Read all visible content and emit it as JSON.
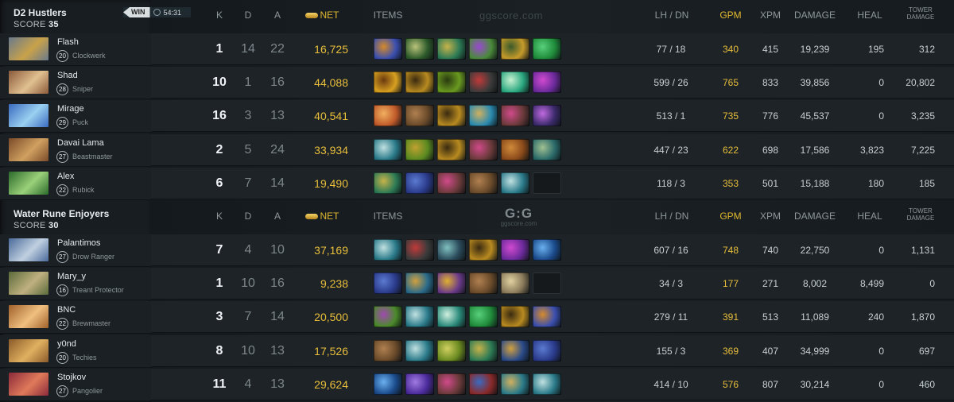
{
  "columns": {
    "k": "K",
    "d": "D",
    "a": "A",
    "net": "NET",
    "items": "ITEMS",
    "lhdn": "LH / DN",
    "gpm": "GPM",
    "xpm": "XPM",
    "damage": "DAMAGE",
    "heal": "HEAL",
    "tower_line1": "TOWER",
    "tower_line2": "DAMAGE"
  },
  "watermark": {
    "site": "ggscore.com",
    "logo": "G:G"
  },
  "match": {
    "result": "WIN",
    "time": "54:31"
  },
  "teams": [
    {
      "name": "D2 Hustlers",
      "score_label": "SCORE",
      "score": "35",
      "players": [
        {
          "name": "Flash",
          "level": "20",
          "hero": "Clockwerk",
          "k": "1",
          "d": "14",
          "a": "22",
          "net": "16,725",
          "lhdn": "77  /  18",
          "gpm": "340",
          "xpm": "415",
          "damage": "19,239",
          "heal": "195",
          "tower": "312",
          "portrait": [
            "#6a7a8c",
            "#c9a24a"
          ],
          "items": [
            [
              "#3a4fb0",
              "#d58a2a"
            ],
            [
              "#2c5a2a",
              "#b9c27a"
            ],
            [
              "#2c7a55",
              "#c6b24a"
            ],
            [
              "#4a8a3a",
              "#9a4ad0"
            ],
            [
              "#c69a2a",
              "#3a5a2a"
            ],
            [
              "#1f8a3a",
              "#58d07a"
            ]
          ]
        },
        {
          "name": "Shad",
          "level": "28",
          "hero": "Sniper",
          "k": "10",
          "d": "1",
          "a": "16",
          "net": "44,088",
          "lhdn": "599  /  26",
          "gpm": "765",
          "xpm": "833",
          "damage": "39,856",
          "heal": "0",
          "tower": "20,802",
          "portrait": [
            "#8a5a3a",
            "#e0c090"
          ],
          "items": [
            [
              "#d8a020",
              "#6a3a10"
            ],
            [
              "#b88a20",
              "#3a2a10"
            ],
            [
              "#6a9a20",
              "#2a3a10"
            ],
            [
              "#3a3a3a",
              "#c03a3a"
            ],
            [
              "#2aa880",
              "#c8f0d0"
            ],
            [
              "#6a2a9a",
              "#d04ad0"
            ]
          ]
        },
        {
          "name": "Mirage",
          "level": "29",
          "hero": "Puck",
          "k": "16",
          "d": "3",
          "a": "13",
          "net": "40,541",
          "lhdn": "513  /  1",
          "gpm": "735",
          "xpm": "776",
          "damage": "45,537",
          "heal": "0",
          "tower": "3,235",
          "portrait": [
            "#3a6ac0",
            "#9ad0f0"
          ],
          "items": [
            [
              "#c05a2a",
              "#f0b060"
            ],
            [
              "#6a4a2a",
              "#b08050"
            ],
            [
              "#b88a20",
              "#3a2a10"
            ],
            [
              "#2a8ab0",
              "#d0b060"
            ],
            [
              "#6a3a3a",
              "#d04a8a"
            ],
            [
              "#3a2a6a",
              "#c06ae0"
            ]
          ]
        },
        {
          "name": "Davai Lama",
          "level": "27",
          "hero": "Beastmaster",
          "k": "2",
          "d": "5",
          "a": "24",
          "net": "33,934",
          "lhdn": "447  /  23",
          "gpm": "622",
          "xpm": "698",
          "damage": "17,586",
          "heal": "3,823",
          "tower": "7,225",
          "portrait": [
            "#7a4a2a",
            "#d0a060"
          ],
          "items": [
            [
              "#2a7a8a",
              "#c0e0e0"
            ],
            [
              "#5a8a20",
              "#c0a030"
            ],
            [
              "#b88a20",
              "#3a2a10"
            ],
            [
              "#6a3a3a",
              "#d04a8a"
            ],
            [
              "#8a4a1a",
              "#d08a3a"
            ],
            [
              "#2a6a6a",
              "#a0c090"
            ]
          ]
        },
        {
          "name": "Alex",
          "level": "22",
          "hero": "Rubick",
          "k": "6",
          "d": "7",
          "a": "14",
          "net": "19,490",
          "lhdn": "118  /  3",
          "gpm": "353",
          "xpm": "501",
          "damage": "15,188",
          "heal": "180",
          "tower": "185",
          "portrait": [
            "#2a6a2a",
            "#9ad07a"
          ],
          "items": [
            [
              "#2c7a55",
              "#c6b24a"
            ],
            [
              "#2a3a8a",
              "#5a7ad0"
            ],
            [
              "#6a3a3a",
              "#d04a8a"
            ],
            [
              "#6a4a2a",
              "#b08050"
            ],
            [
              "#2a7a8a",
              "#c0e0e0"
            ],
            null
          ]
        }
      ]
    },
    {
      "name": "Water Rune Enjoyers",
      "score_label": "SCORE",
      "score": "30",
      "players": [
        {
          "name": "Palantimos",
          "level": "27",
          "hero": "Drow Ranger",
          "k": "7",
          "d": "4",
          "a": "10",
          "net": "37,169",
          "lhdn": "607  /  16",
          "gpm": "748",
          "xpm": "740",
          "damage": "22,750",
          "heal": "0",
          "tower": "1,131",
          "portrait": [
            "#4a6a9a",
            "#c0d0e0"
          ],
          "items": [
            [
              "#2a7a8a",
              "#c0e0e0"
            ],
            [
              "#3a3a3a",
              "#c03a3a"
            ],
            [
              "#2a4a5a",
              "#80c0c0"
            ],
            [
              "#b88a20",
              "#3a2a10"
            ],
            [
              "#6a2a9a",
              "#d04ad0"
            ],
            [
              "#1a4a8a",
              "#6ab0f0"
            ]
          ]
        },
        {
          "name": "Mary_y",
          "level": "16",
          "hero": "Treant Protector",
          "k": "1",
          "d": "10",
          "a": "16",
          "net": "9,238",
          "lhdn": "34  /  3",
          "gpm": "177",
          "xpm": "271",
          "damage": "8,002",
          "heal": "8,499",
          "tower": "0",
          "portrait": [
            "#5a6a3a",
            "#c0b080"
          ],
          "items": [
            [
              "#2a3a8a",
              "#5a7ad0"
            ],
            [
              "#2a6a8a",
              "#d0a040"
            ],
            [
              "#6a3a8a",
              "#e0b030"
            ],
            [
              "#6a4a2a",
              "#b08050"
            ],
            [
              "#8a7a5a",
              "#e0d0a0"
            ],
            null
          ]
        },
        {
          "name": "BNC",
          "level": "22",
          "hero": "Brewmaster",
          "k": "3",
          "d": "7",
          "a": "14",
          "net": "20,500",
          "lhdn": "279  /  11",
          "gpm": "391",
          "xpm": "513",
          "damage": "11,089",
          "heal": "240",
          "tower": "1,870",
          "portrait": [
            "#a0602a",
            "#f0c080"
          ],
          "items": [
            [
              "#4a8a2a",
              "#a04ab0"
            ],
            [
              "#2a7a8a",
              "#c0e0e0"
            ],
            [
              "#2a8a7a",
              "#d0f0e0"
            ],
            [
              "#1f8a3a",
              "#58d07a"
            ],
            [
              "#b88a20",
              "#3a2a10"
            ],
            [
              "#3a4fb0",
              "#d58a2a"
            ]
          ]
        },
        {
          "name": "y0nd",
          "level": "20",
          "hero": "Techies",
          "k": "8",
          "d": "10",
          "a": "13",
          "net": "17,526",
          "lhdn": "155  /  3",
          "gpm": "369",
          "xpm": "407",
          "damage": "34,999",
          "heal": "0",
          "tower": "697",
          "portrait": [
            "#8a5a2a",
            "#e0b060"
          ],
          "items": [
            [
              "#6a4a2a",
              "#b08050"
            ],
            [
              "#2a7a8a",
              "#c0e0e0"
            ],
            [
              "#6a8a20",
              "#d0d060"
            ],
            [
              "#2c7a55",
              "#c6b24a"
            ],
            [
              "#2a4a8a",
              "#d0a040"
            ],
            [
              "#2a3a8a",
              "#5a7ad0"
            ]
          ]
        },
        {
          "name": "Stojkov",
          "level": "27",
          "hero": "Pangolier",
          "k": "11",
          "d": "4",
          "a": "13",
          "net": "29,624",
          "lhdn": "414  /  10",
          "gpm": "576",
          "xpm": "807",
          "damage": "30,214",
          "heal": "0",
          "tower": "460",
          "portrait": [
            "#8a2a3a",
            "#e07a5a"
          ],
          "items": [
            [
              "#1a4a8a",
              "#6ab0f0"
            ],
            [
              "#4a2a9a",
              "#a07ae0"
            ],
            [
              "#6a3a3a",
              "#d04a8a"
            ],
            [
              "#8a2a2a",
              "#3a6ac0"
            ],
            [
              "#2a7a8a",
              "#d0b060"
            ],
            [
              "#2a7a8a",
              "#c0e0e0"
            ]
          ]
        }
      ]
    }
  ]
}
